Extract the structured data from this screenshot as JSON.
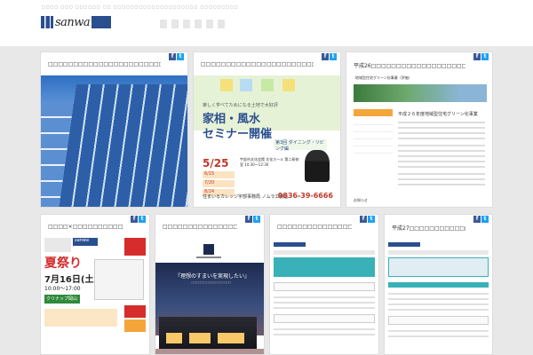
{
  "header": {
    "tagline": "□□□□ □□□ □□□□□□ □□ □□□□□□□□□□□□□□□□□□□□ □□□□□□□□□",
    "logo_text": "sanwa"
  },
  "cards": {
    "c1": {
      "title": "□□□□□□□□□□□□□□□□□□□□□□□□"
    },
    "c2": {
      "title": "□□□□□□□□□□□□□□□□□□□□□□□□□□□□",
      "flyer_top": "楽しく学べてためになる土地で大好評",
      "headline1": "家相・風水",
      "headline2": "セミナー開催",
      "subtag": "第3回 ダイニング・リビング編",
      "date": "5/25",
      "info": "宇部市文化会館 文化ホール 第二研修室 10:30〜12:30",
      "rows": [
        "6/15",
        "7/20",
        "8/24"
      ],
      "phone": "0836-39-6666",
      "footer": "住まいるカレッジ宇部事務局 ノムラ工務店"
    },
    "c3": {
      "title": "平成26□□□□□□□□□□□□□□□□□□□□□□□□□□□□□□□□□□□",
      "doc_header": "地域型住宅グリーン化事業（評価）",
      "doc_heading": "平成２６年度地域型住宅グリーン化事業",
      "news": "お知らせ"
    },
    "c4": {
      "title": "□□□□×□□□□□□□□□□□□□ in □□",
      "banner": "夏祭り",
      "logo_text": "sanwa",
      "date": "7月16日(土)",
      "time": "10:00〜17:00",
      "place": "クリナップ岡山ショールーム"
    },
    "c5": {
      "title": "□□□□□□□□□□□□□□□□□□",
      "quote": "『理想のすまいを実現したい』",
      "sub": "□□□□□□□□□□□□□□□□"
    },
    "c6": {
      "title": "□□□□□□□□□□□□□□□□□□□□□□□"
    },
    "c7": {
      "title": "□□□□□□□□□□□□□□□□□□□□□□□"
    },
    "c8": {
      "title": "平成27□□□□□□□□□□□□□□□□□□□□□□□□□□□□"
    }
  },
  "share": {
    "fb": "f",
    "tw": "t"
  },
  "colors": {
    "brand": "#2a4f8f",
    "facebook": "#3b5998",
    "twitter": "#1da1f2",
    "accent_red": "#c0392b"
  }
}
